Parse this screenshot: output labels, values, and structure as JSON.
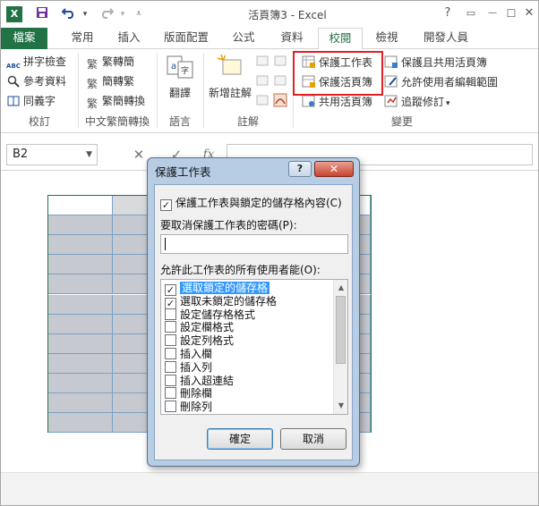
{
  "window": {
    "title": "活頁簿3 - Excel",
    "app_logo": "X"
  },
  "window_controls": {
    "help": "?",
    "restore": "▭",
    "minimize": "—",
    "maximize": "☐",
    "close": "✕"
  },
  "quick_access": {
    "save_icon": "save-icon",
    "undo_icon": "undo-icon",
    "redo_icon": "redo-icon",
    "customize_icon": "customize-icon"
  },
  "tabs": [
    "檔案",
    "常用",
    "插入",
    "版面配置",
    "公式",
    "資料",
    "校閱",
    "檢視",
    "開發人員"
  ],
  "active_tab": "校閱",
  "ribbon": {
    "proofing": {
      "spell": "拼字檢查",
      "research": "參考資料",
      "thesaurus": "同義字",
      "label": "校訂",
      "abc": "ABC"
    },
    "chinese": {
      "t2s": "繁轉簡",
      "s2t": "簡轉繁",
      "convert": "繁簡轉換",
      "label": "中文繁簡轉換"
    },
    "language": {
      "translate": "翻譯",
      "label": "語言"
    },
    "comments": {
      "new_comment": "新增註解",
      "label": "註解"
    },
    "changes": {
      "protect_sheet": "保護工作表",
      "protect_workbook": "保護活頁簿",
      "share_workbook": "共用活頁簿",
      "protect_share": "保護且共用活頁簿",
      "allow_edit": "允許使用者編輯範圍",
      "track_changes": "追蹤修訂",
      "track_dropdown": "▾",
      "label": "變更"
    },
    "colors": {
      "accent": "#217346",
      "highlight": "#e02020"
    }
  },
  "formula_bar": {
    "name_box": "B2",
    "cancel": "✕",
    "enter": "✓",
    "fx": "fx"
  },
  "dialog": {
    "title": "保護工作表",
    "help_btn": "?",
    "close_btn": "✕",
    "protect_option": "保護工作表與鎖定的儲存格內容(C)",
    "password_label": "要取消保護工作表的密碼(P):",
    "password_value": "",
    "allow_label": "允許此工作表的所有使用者能(O):",
    "permissions": [
      {
        "label": "選取鎖定的儲存格",
        "checked": "✓"
      },
      {
        "label": "選取未鎖定的儲存格",
        "checked": "✓"
      },
      {
        "label": "設定儲存格格式",
        "checked": ""
      },
      {
        "label": "設定欄格式",
        "checked": ""
      },
      {
        "label": "設定列格式",
        "checked": ""
      },
      {
        "label": "插入欄",
        "checked": ""
      },
      {
        "label": "插入列",
        "checked": ""
      },
      {
        "label": "插入超連結",
        "checked": ""
      },
      {
        "label": "刪除欄",
        "checked": ""
      },
      {
        "label": "刪除列",
        "checked": ""
      }
    ],
    "protect_checked": "✓",
    "scroll_up": "▲",
    "scroll_down": "▼",
    "ok": "確定",
    "cancel": "取消"
  }
}
